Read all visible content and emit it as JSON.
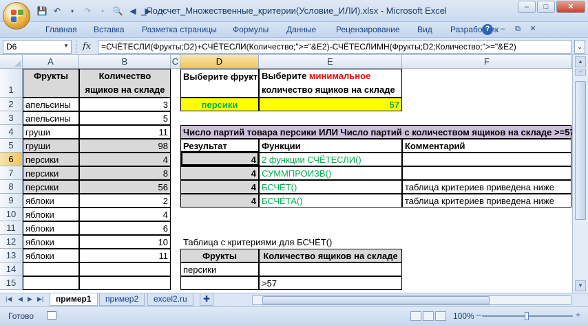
{
  "window": {
    "title": "_Подсчет_Множественные_критерии(Условие_ИЛИ).xlsx - Microsoft Excel",
    "controls": {
      "minimize": "–",
      "maximize": "□",
      "close": "✕"
    }
  },
  "ribbon": {
    "tabs": [
      "Главная",
      "Вставка",
      "Разметка страницы",
      "Формулы",
      "Данные",
      "Рецензирование",
      "Вид",
      "Разработчик"
    ]
  },
  "formula_bar": {
    "name_box": "D6",
    "fx": "fx",
    "formula": "=СЧЁТЕСЛИ(Фрукты;D2)+СЧЁТЕСЛИ(Количество;\">=\"&E2)-СЧЁТЕСЛИМН(Фрукты;D2;Количество;\">=\"&E2)"
  },
  "columns": [
    "A",
    "B",
    "C",
    "D",
    "E",
    "F"
  ],
  "rows": [
    "1",
    "2",
    "3",
    "4",
    "5",
    "6",
    "7",
    "8",
    "9",
    "10",
    "11",
    "12",
    "13",
    "14",
    "15"
  ],
  "table_left": {
    "header": {
      "fruits": "Фрукты",
      "qty": "Количество ящиков на складе"
    },
    "data": [
      {
        "fruit": "апельсины",
        "qty": "3"
      },
      {
        "fruit": "апельсины",
        "qty": "5"
      },
      {
        "fruit": "груши",
        "qty": "11"
      },
      {
        "fruit": "груши",
        "qty": "98"
      },
      {
        "fruit": "персики",
        "qty": "4"
      },
      {
        "fruit": "персики",
        "qty": "8"
      },
      {
        "fruit": "персики",
        "qty": "56"
      },
      {
        "fruit": "яблоки",
        "qty": "2"
      },
      {
        "fruit": "яблоки",
        "qty": "4"
      },
      {
        "fruit": "яблоки",
        "qty": "6"
      },
      {
        "fruit": "яблоки",
        "qty": "10"
      },
      {
        "fruit": "яблоки",
        "qty": "11"
      }
    ]
  },
  "criteria": {
    "d1": "Выберите фрукт",
    "e1_part1": "Выберите ",
    "e1_part2": "минимальное",
    "e1_part3": "количество ящиков на складе",
    "d2": "персики",
    "e2": "57"
  },
  "results": {
    "banner": "Число партий товара персики ИЛИ Число партий с количеством ящиков на складе >=57",
    "headers": {
      "result": "Результат",
      "functions": "Функции",
      "comment": "Комментарий"
    },
    "rows": [
      {
        "value": "4",
        "function": "2 функции СЧЁТЕСЛИ()",
        "comment": ""
      },
      {
        "value": "4",
        "function": "СУММПРОИЗВ()",
        "comment": ""
      },
      {
        "value": "4",
        "function": "БСЧЁТ()",
        "comment": "таблица критериев приведена ниже"
      },
      {
        "value": "4",
        "function": "БСЧЁТА()",
        "comment": "таблица критериев приведена ниже"
      }
    ]
  },
  "criteria_table": {
    "title": "Таблица с критериями для БСЧЁТ()",
    "headers": {
      "fruits": "Фрукты",
      "qty": "Количество ящиков на складе"
    },
    "row1": {
      "fruit": "персики",
      "qty": ""
    },
    "row2": {
      "fruit": "",
      "qty": ">57"
    }
  },
  "sheet_tabs": [
    "пример1",
    "пример2",
    "excel2.ru"
  ],
  "status": {
    "text": "Готово",
    "zoom": "100%",
    "zoom_level_percent": 100
  },
  "colors": {
    "highlight_yellow": "#ffff00",
    "header_lavender": "#ccc0da",
    "green_text": "#00b050",
    "red_text": "#ff0000",
    "gray_fill": "#d9d9d9"
  }
}
